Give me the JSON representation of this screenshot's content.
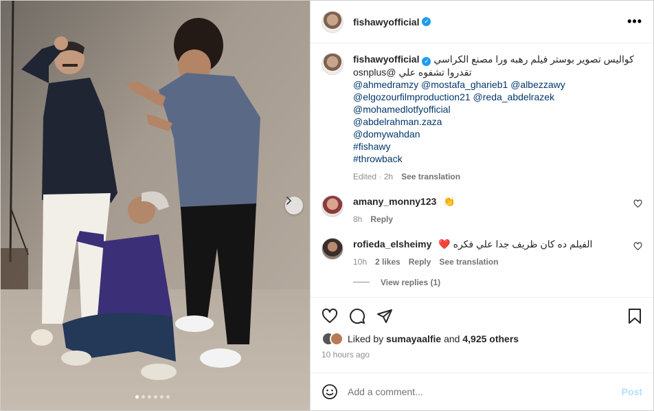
{
  "post": {
    "username": "fishawyofficial",
    "menu_icon": "more-horizontal-icon",
    "photo_count": 6,
    "active_photo": 1
  },
  "caption": {
    "username": "fishawyofficial",
    "line1": "كواليس تصوير بوستر فيلم رهبه ورا مصنع الكراسي",
    "line2": "تقدروا تشفوه علي @osnplus",
    "tags_line1": "@ahmedramzy @mostafa_gharieb1 @albezzawy",
    "tags_line2": "@elgozourfilmproduction21 @reda_abdelrazek",
    "tags": [
      "@mohamedlotfyofficial",
      "@abdelrahman.zaza",
      "@domywahdan",
      "#fishawy",
      "#throwback"
    ],
    "edited": "Edited",
    "time": "2h",
    "see_translation": "See translation"
  },
  "comments": [
    {
      "username": "amany_monny123",
      "text": "👏",
      "time": "8h",
      "reply": "Reply"
    },
    {
      "username": "rofieda_elsheimy",
      "text": "الفيلم ده كان ظريف جدا علي فكره ❤️",
      "time": "10h",
      "likes": "2 likes",
      "reply": "Reply",
      "see_translation": "See translation",
      "view_replies": "View replies (1)"
    }
  ],
  "likes": {
    "prefix": "Liked by",
    "user": "sumayaalfie",
    "and": "and",
    "count": "4,925 others"
  },
  "timestamp": "10 hours ago",
  "composer": {
    "placeholder": "Add a comment...",
    "post_label": "Post"
  },
  "colors": {
    "link": "#00376b",
    "verified": "#1d9bf0",
    "post_disabled": "#b2dffc"
  }
}
